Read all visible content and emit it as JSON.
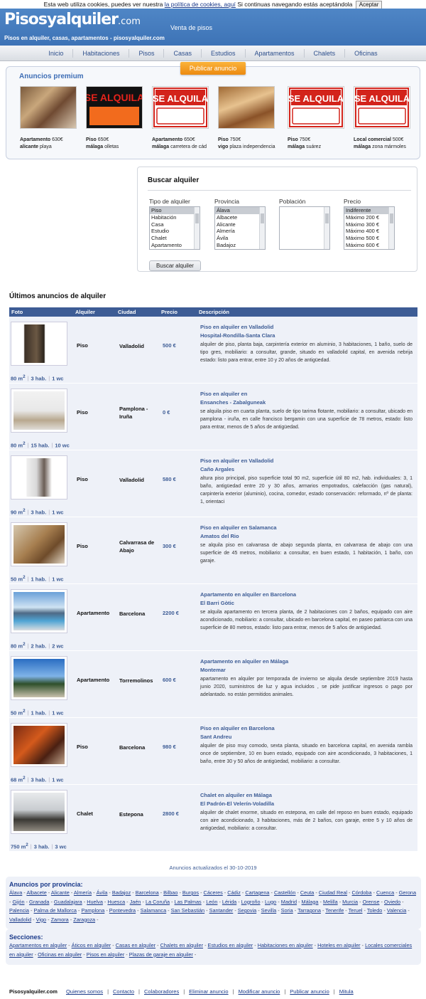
{
  "cookie": {
    "text_before": "Esta web utiliza cookies, puedes ver nuestra",
    "link": "la política de cookies, aquí",
    "text_after": "Si continuas navegando estás aceptándola",
    "button": "Aceptar"
  },
  "header": {
    "logo": "Pisosyalquiler",
    "logo_domain": ".com",
    "tagline": "Venta de pisos",
    "subline": "Pisos en alquiler, casas, apartamentos - pisosyalquiler.com"
  },
  "nav": [
    "Inicio",
    "Habitaciones",
    "Pisos",
    "Casas",
    "Estudios",
    "Apartamentos",
    "Chalets",
    "Oficinas"
  ],
  "premium": {
    "title": "Anuncios premium",
    "publish_button": "Publicar anuncio",
    "cards": [
      {
        "type": "Apartamento",
        "price": "630€",
        "city": "alicante",
        "area": "playa",
        "image": "photo-living-room"
      },
      {
        "type": "Piso",
        "price": "650€",
        "city": "málaga",
        "area": "olletas",
        "image": "se-alquila-sign-orange",
        "sign": "SE ALQUILA"
      },
      {
        "type": "Apartamento",
        "price": "650€",
        "city": "málaga",
        "area": "carretera de cád",
        "image": "se-alquila-sign",
        "sign": "SE ALQUILA"
      },
      {
        "type": "Piso",
        "price": "750€",
        "city": "vigo",
        "area": "plaza independencia",
        "image": "photo-salon"
      },
      {
        "type": "Piso",
        "price": "750€",
        "city": "málaga",
        "area": "suárez",
        "image": "se-alquila-sign",
        "sign": "SE ALQUILA"
      },
      {
        "type": "Local comercial",
        "price": "500€",
        "city": "málaga",
        "area": "zona mármoles",
        "image": "se-alquila-sign",
        "sign": "SE ALQUILA"
      }
    ]
  },
  "search": {
    "title": "Buscar alquiler",
    "tipo_label": "Tipo de alquiler",
    "tipo_options": [
      "Piso",
      "Habitación",
      "Casa",
      "Estudio",
      "Chalet",
      "Apartamento"
    ],
    "provincia_label": "Provincia",
    "provincia_options": [
      "Álava",
      "Albacete",
      "Alicante",
      "Almería",
      "Ávila",
      "Badajoz"
    ],
    "poblacion_label": "Población",
    "precio_label": "Precio",
    "precio_options": [
      "Indiferente",
      "Máximo 200 €",
      "Máximo 300 €",
      "Máximo 400 €",
      "Máximo 500 €",
      "Máximo 600 €"
    ],
    "button": "Buscar alquiler"
  },
  "listings": {
    "title": "Últimos anuncios de alquiler",
    "columns": [
      "Foto",
      "Alquiler",
      "Ciudad",
      "Precio",
      "Descripción"
    ],
    "rows": [
      {
        "tipo": "Piso",
        "ciudad": "Valladolid",
        "precio": "500 €",
        "titulo": "Piso en alquiler en Valladolid",
        "zona": "Hospital-Rondilla-Santa Clara",
        "desc": "alquiler de piso, planta baja, carpintería exterior en aluminio, 3 habitaciones, 1 baño, suelo de tipo gres, mobiliario: a consultar, grande, situado en valladolid capital, en avenida nebrija estado: listo para entrar, entre 10 y 20 años de antigüedad.",
        "m2": "80 m",
        "hab": "3 hab.",
        "wc": "1 wc"
      },
      {
        "tipo": "Piso",
        "ciudad": "Pamplona - Iruña",
        "precio": "0 €",
        "titulo": "Piso en alquiler en",
        "zona": "Ensanches - Zabalguneak",
        "desc": "se alquila piso en cuarta planta, suelo de tipo tarima flotante, mobiliario: a consultar, ubicado en pamplona - iruña, en calle francisco bergamin con una superficie de 78 metros, estado: listo para entrar, menos de 5 años de antigüedad.",
        "m2": "80 m",
        "hab": "15 hab.",
        "wc": "10 wc"
      },
      {
        "tipo": "Piso",
        "ciudad": "Valladolid",
        "precio": "580 €",
        "titulo": "Piso en alquiler en Valladolid",
        "zona": "Caño Argales",
        "desc": "altura piso principal, piso superficie total 90 m2, superficie útil 80 m2, hab. individuales: 3, 1 baño, antigüedad entre 20 y 30 años, armarios empotrados, calefacción (gas natural), carpintería exterior (aluminio), cocina, comedor, estado conservación: reformado, nº de planta: 1, orientaci",
        "m2": "90 m",
        "hab": "3 hab.",
        "wc": "1 wc"
      },
      {
        "tipo": "Piso",
        "ciudad": "Calvarrasa de Abajo",
        "precio": "300 €",
        "titulo": "Piso en alquiler en Salamanca",
        "zona": "Amatos del Rio",
        "desc": "se alquila piso en calvarrasa de abajo segunda planta, en calvarrasa de abajo con una superficie de 45 metros, mobiliario: a consultar, en buen estado, 1 habitación, 1 baño, con garaje.",
        "m2": "50 m",
        "hab": "1 hab.",
        "wc": "1 wc"
      },
      {
        "tipo": "Apartamento",
        "ciudad": "Barcelona",
        "precio": "2200 €",
        "titulo": "Apartamento en alquiler en Barcelona",
        "zona": "El Barri Gòtic",
        "desc": "se alquila apartamento en tercera planta, de 2 habitaciones con 2 baños, equipado con aire acondicionado, mobiliario: a consultar, ubicado en barcelona capital, en paseo patriarca con una superficie de 80 metros, estado: listo para entrar, menos de 5 años de antigüedad.",
        "m2": "80 m",
        "hab": "2 hab.",
        "wc": "2 wc"
      },
      {
        "tipo": "Apartamento",
        "ciudad": "Torremolinos",
        "precio": "600 €",
        "titulo": "Apartamento en alquiler en Málaga",
        "zona": "Montemar",
        "desc": "apartamento en alquiler por temporada de invierno se alquila desde septiembre 2019 hasta junio 2020, suministros de luz y agua incluidos , se pide justificar ingresos o pago por adelantado. no están permitidos animales.",
        "m2": "50 m",
        "hab": "1 hab.",
        "wc": "1 wc"
      },
      {
        "tipo": "Piso",
        "ciudad": "Barcelona",
        "precio": "980 €",
        "titulo": "Piso en alquiler en Barcelona",
        "zona": "Sant Andreu",
        "desc": "alquiler de piso muy comodo, sexta planta, situado en barcelona capital, en avenida rambla once de septiembre, 10 en buen estado, equipado con aire acondicionado, 3 habitaciones, 1 baño, entre 30 y 50 años de antigüedad, mobiliario: a consultar.",
        "m2": "68 m",
        "hab": "3 hab.",
        "wc": "1 wc"
      },
      {
        "tipo": "Chalet",
        "ciudad": "Estepona",
        "precio": "2800 €",
        "titulo": "Chalet en alquiler en Málaga",
        "zona": "El Padrón-El Velerín-Voladilla",
        "desc": "alquiler de chalet enorme, situado en estepona, en calle del reposo en buen estado, equipado con aire acondicionado, 3 habitaciones, más de 2 baños, con garaje, entre 5 y 10 años de antigüedad, mobiliario: a consultar.",
        "m2": "750 m",
        "hab": "3 hab.",
        "wc": "3 wc"
      }
    ],
    "updated": "Anuncios actualizados el 30-10-2019"
  },
  "provincias": {
    "title": "Anuncios por provincia:",
    "items": [
      "Álava",
      "Albacete",
      "Alicante",
      "Almería",
      "Ávila",
      "Badajoz",
      "Barcelona",
      "Bilbao",
      "Burgos",
      "Cáceres",
      "Cádiz",
      "Cartagena",
      "Castellón",
      "Ceuta",
      "Ciudad Real",
      "Córdoba",
      "Cuenca",
      "Gerona",
      "Gijón",
      "Granada",
      "Guadalajara",
      "Huelva",
      "Huesca",
      "Jaén",
      "La Coruña",
      "Las Palmas",
      "León",
      "Lérida",
      "Logroño",
      "Lugo",
      "Madrid",
      "Málaga",
      "Melilla",
      "Murcia",
      "Orense",
      "Oviedo",
      "Palencia",
      "Palma de Mallorca",
      "Pamplona",
      "Pontevedra",
      "Salamanca",
      "San Sebastián",
      "Santander",
      "Segovia",
      "Sevilla",
      "Soria",
      "Tarragona",
      "Tenerife",
      "Teruel",
      "Toledo",
      "Valencia",
      "Valladolid",
      "Vigo",
      "Zamora",
      "Zaragoza"
    ]
  },
  "secciones": {
    "title": "Secciones:",
    "items": [
      "Apartamentos en alquiler",
      "Áticos en alquiler",
      "Casas en alquiler",
      "Chalets en alquiler",
      "Estudios en alquiler",
      "Habitaciones en alquiler",
      "Hoteles en alquiler",
      "Locales comerciales en alquiler",
      "Oficinas en alquiler",
      "Pisos en alquiler",
      "Plazas de garaje en alquiler"
    ]
  },
  "footer": {
    "brand": "Pisosyalquiler.com",
    "links": [
      "Quienes somos",
      "Contacto",
      "Colaboradores",
      "Eliminar anuncio",
      "Modificar anuncio",
      "Publicar anuncio",
      "Mitula"
    ]
  }
}
